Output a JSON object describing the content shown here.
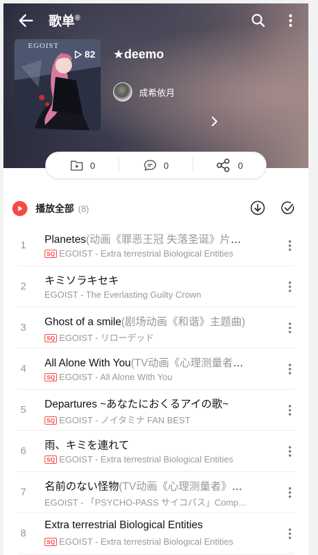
{
  "header": {
    "title": "歌单",
    "title_mark": "®"
  },
  "playlist": {
    "cover_logo": "EGOIST",
    "play_count": "82",
    "name": "★deemo",
    "creator": "成希依月"
  },
  "actions": {
    "collect_count": "0",
    "comment_count": "0",
    "share_count": "0"
  },
  "play_all": {
    "label": "播放全部",
    "count": "(8)"
  },
  "colors": {
    "accent": "#f44a45",
    "sq_badge": "#f44a45"
  },
  "songs": [
    {
      "index": "1",
      "title": "Planetes",
      "subtitle": "(动画《罪恶王冠 失落圣诞》片尾曲)",
      "badge": "SQ",
      "meta": "EGOIST - Extra terrestrial Biological Entities"
    },
    {
      "index": "2",
      "title": "キミソラキセキ",
      "subtitle": "",
      "badge": "",
      "meta": "EGOIST - The Everlasting Guilty Crown"
    },
    {
      "index": "3",
      "title": "Ghost of a smile",
      "subtitle": "(剧场动画《和谐》主题曲)",
      "badge": "SQ",
      "meta": "EGOIST - リローデッド"
    },
    {
      "index": "4",
      "title": "All Alone With You",
      "subtitle": "(TV动画《心理测量者》片尾曲)",
      "badge": "SQ",
      "meta": "EGOIST - All Alone With You"
    },
    {
      "index": "5",
      "title": "Departures ~あなたにおくるアイの歌~",
      "subtitle": "",
      "badge": "SQ",
      "meta": "EGOIST - ノイタミナ FAN BEST"
    },
    {
      "index": "6",
      "title": "雨、キミを連れて",
      "subtitle": "",
      "badge": "SQ",
      "meta": "EGOIST - Extra terrestrial Biological Entities"
    },
    {
      "index": "7",
      "title": "名前のない怪物",
      "subtitle": "(TV动画《心理测量者》片尾曲)",
      "badge": "",
      "meta": "EGOIST - 「PSYCHO-PASS サイコパス」Complete Original Soundtrack"
    },
    {
      "index": "8",
      "title": "Extra terrestrial Biological Entities",
      "subtitle": "",
      "badge": "SQ",
      "meta": "EGOIST - Extra terrestrial Biological Entities"
    }
  ]
}
